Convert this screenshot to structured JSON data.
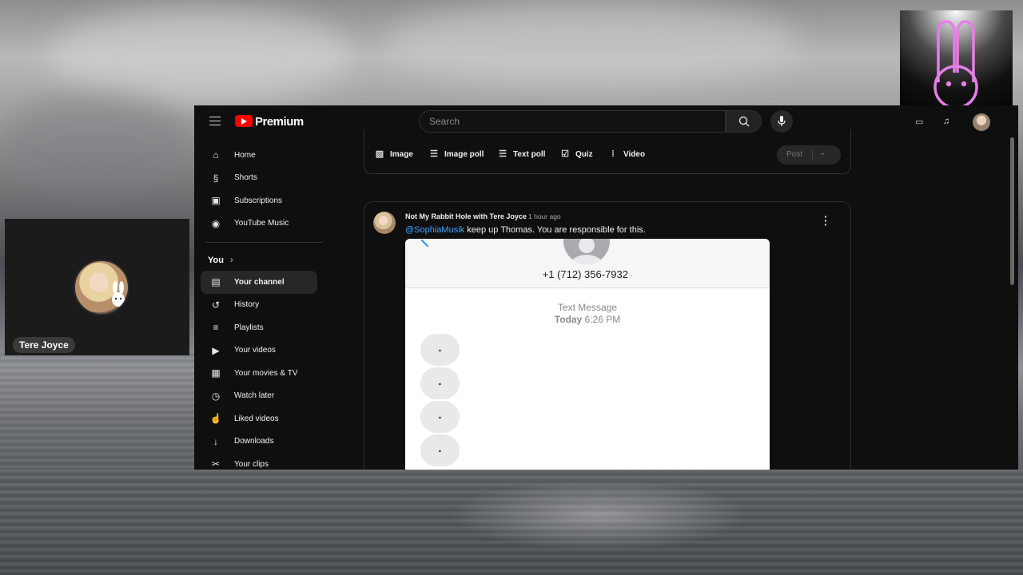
{
  "webcam": {
    "name": "Tere Joyce"
  },
  "youtube": {
    "brand": "Premium",
    "search": {
      "placeholder": "Search"
    },
    "sidebar": {
      "main": [
        {
          "label": "Home",
          "icon": "home-icon"
        },
        {
          "label": "Shorts",
          "icon": "shorts-icon"
        },
        {
          "label": "Subscriptions",
          "icon": "subscriptions-icon"
        },
        {
          "label": "YouTube Music",
          "icon": "music-icon"
        }
      ],
      "you_heading": "You",
      "you": [
        {
          "label": "Your channel",
          "icon": "channel-icon",
          "active": true
        },
        {
          "label": "History",
          "icon": "history-icon"
        },
        {
          "label": "Playlists",
          "icon": "playlists-icon"
        },
        {
          "label": "Your videos",
          "icon": "videos-icon"
        },
        {
          "label": "Your movies & TV",
          "icon": "movies-icon"
        },
        {
          "label": "Watch later",
          "icon": "clock-icon"
        },
        {
          "label": "Liked videos",
          "icon": "thumbs-up-icon"
        },
        {
          "label": "Downloads",
          "icon": "download-icon"
        },
        {
          "label": "Your clips",
          "icon": "scissors-icon"
        }
      ]
    },
    "post_tools": [
      {
        "label": "Image",
        "icon": "image-icon"
      },
      {
        "label": "Image poll",
        "icon": "image-poll-icon"
      },
      {
        "label": "Text poll",
        "icon": "text-poll-icon"
      },
      {
        "label": "Quiz",
        "icon": "quiz-icon"
      },
      {
        "label": "Video",
        "icon": "video-icon"
      }
    ],
    "post_button": "Post",
    "community_post": {
      "author": "Not My Rabbit Hole with Tere Joyce",
      "time": "1 hour ago",
      "mention": "@SophiaMusik",
      "text": " keep up Thomas. You are responsible for this.",
      "screenshot": {
        "phone_number": "+1 (712) 356-7932",
        "label_line1": "Text Message",
        "label_line2_day": "Today",
        "label_line2_time": "6:26 PM",
        "bubbles": [
          ".",
          ".",
          ".",
          "."
        ]
      }
    }
  },
  "colors": {
    "accent_red": "#ff0000",
    "link_blue": "#3ea6ff",
    "logo_pink": "#e77ee8"
  }
}
